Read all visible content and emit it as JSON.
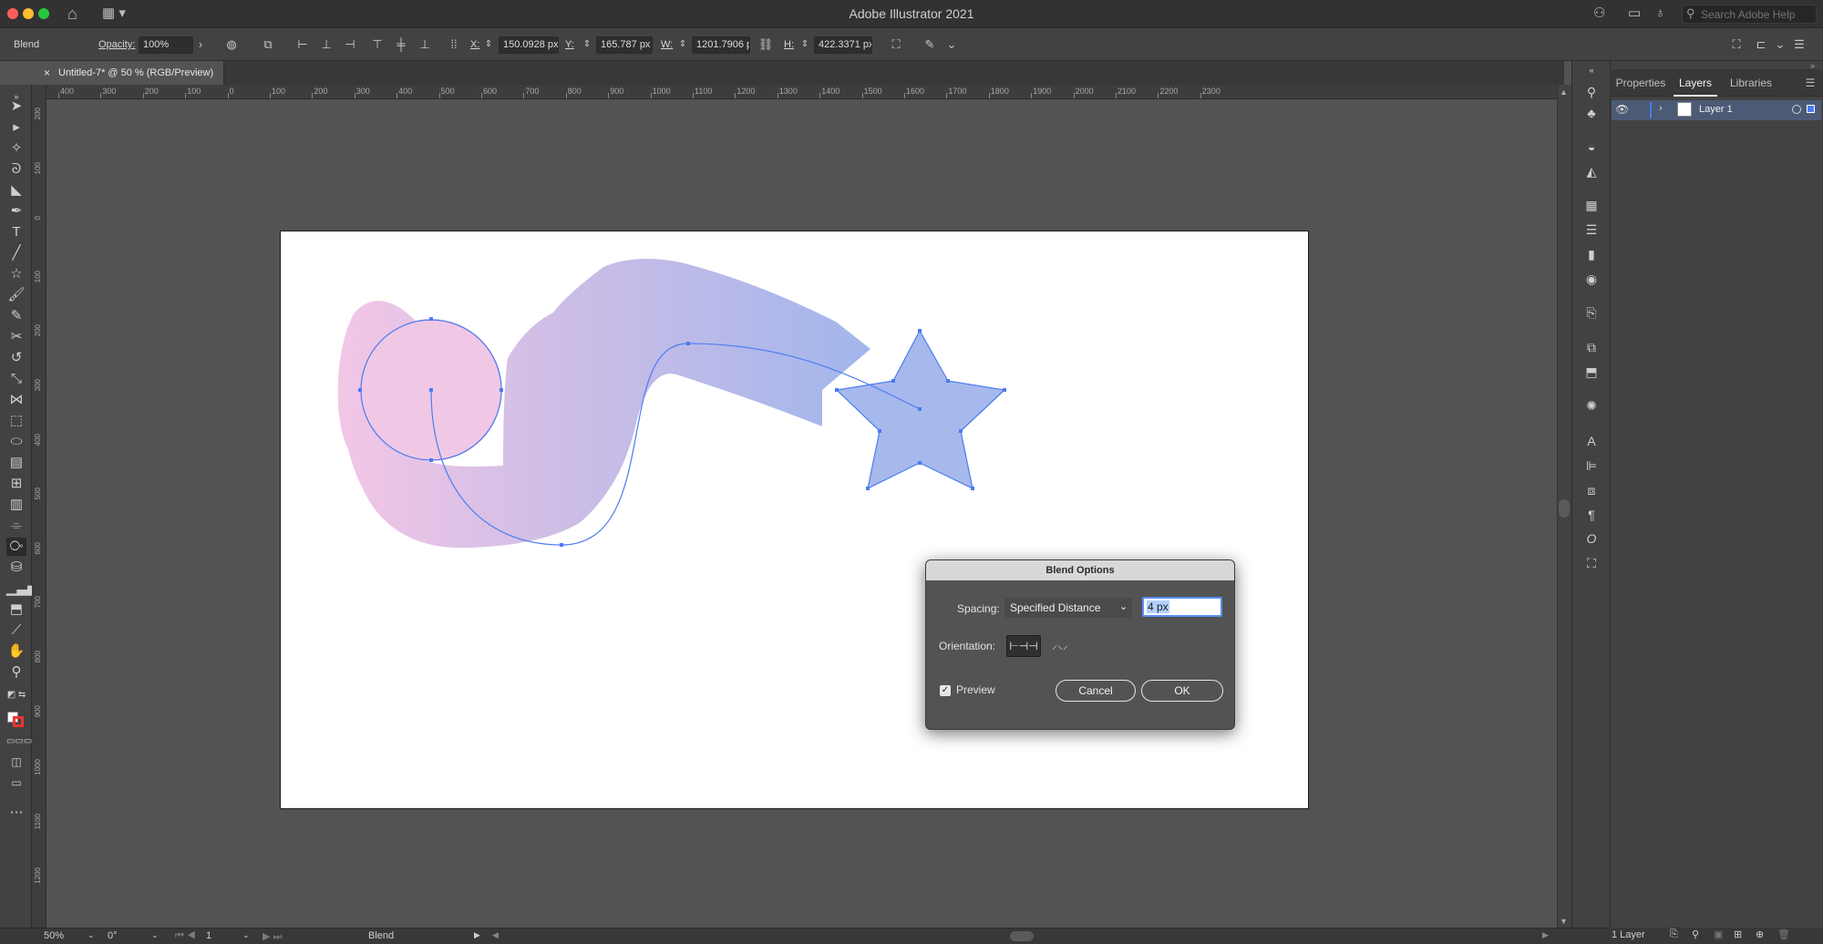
{
  "window": {
    "title": "Adobe Illustrator 2021"
  },
  "titlebar": {
    "search_placeholder": "Search Adobe Help"
  },
  "controlbar": {
    "selection_label": "Blend",
    "opacity_label": "Opacity:",
    "opacity_value": "100%",
    "x_label": "X:",
    "x_value": "150.0928 px",
    "y_label": "Y:",
    "y_value": "165.787 px",
    "w_label": "W:",
    "w_value": "1201.7906 px",
    "h_label": "H:",
    "h_value": "422.3371 px"
  },
  "document": {
    "tab_title": "Untitled-7* @ 50 % (RGB/Preview)"
  },
  "ruler_top_labels": [
    "400",
    "300",
    "200",
    "100",
    "0",
    "100",
    "200",
    "300",
    "400",
    "500",
    "600",
    "700",
    "800",
    "900",
    "1000",
    "1100",
    "1200",
    "1300",
    "1400",
    "1500",
    "1600",
    "1700",
    "1800",
    "1900",
    "2000",
    "2100",
    "2200",
    "2300"
  ],
  "ruler_left_labels": [
    "200",
    "100",
    "0",
    "100",
    "200",
    "300",
    "400",
    "500",
    "600",
    "700",
    "800",
    "900",
    "1000",
    "1100",
    "1200"
  ],
  "panels": {
    "tabs": [
      "Properties",
      "Layers",
      "Libraries"
    ],
    "active_tab": "Layers",
    "layers": [
      {
        "name": "Layer 1",
        "visible": true
      }
    ],
    "status": "1 Layer"
  },
  "statusbar": {
    "zoom": "50%",
    "rotation": "0°",
    "artboard_number": "1",
    "tool_name": "Blend"
  },
  "dialog": {
    "title": "Blend Options",
    "spacing_label": "Spacing:",
    "spacing_option": "Specified Distance",
    "spacing_value": "4 px",
    "orientation_label": "Orientation:",
    "preview_label": "Preview",
    "preview_checked": true,
    "cancel_label": "Cancel",
    "ok_label": "OK"
  },
  "colors": {
    "accent": "#4a7cf0",
    "blend_start": "#f0c6e6",
    "blend_end": "#a3b8ec"
  }
}
